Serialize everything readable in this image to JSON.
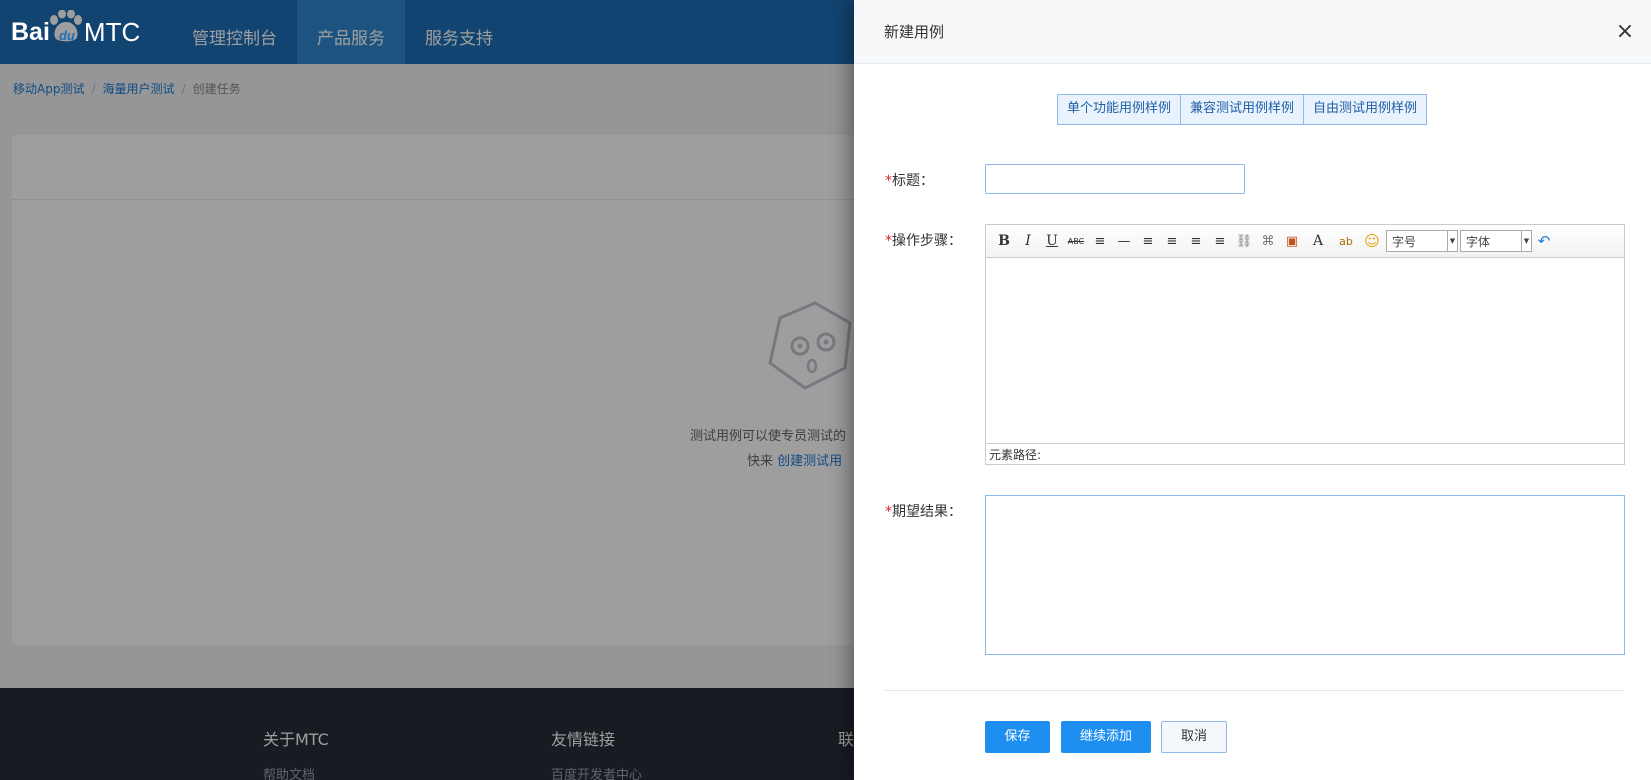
{
  "header": {
    "logo_bai": "Bai",
    "logo_du": "du",
    "logo_mtc": "MTC",
    "nav": [
      "管理控制台",
      "产品服务",
      "服务支持"
    ]
  },
  "breadcrumb": [
    "移动App测试",
    "海量用户测试",
    "创建任务"
  ],
  "empty_state": {
    "line1": "测试用例可以使专员测试的",
    "line2_prefix": "快来",
    "line2_link": "创建测试用"
  },
  "footer": {
    "col1_title": "关于MTC",
    "col1_link": "帮助文档",
    "col2_title": "友情链接",
    "col2_link": "百度开发者中心",
    "col3_title": "联"
  },
  "drawer": {
    "title": "新建用例",
    "close": "×",
    "samples": [
      "单个功能用例样例",
      "兼容测试用例样例",
      "自由测试用例样例"
    ],
    "required_mark": "*",
    "title_label": "标题：",
    "steps_label": "操作步骤：",
    "result_label": "期望结果：",
    "editor": {
      "toolbar": [
        "B",
        "I",
        "U",
        "ABC",
        "≡",
        "—",
        "≡",
        "≡",
        "≡",
        "≡",
        "⛓",
        "⌘",
        "▣",
        "A",
        "ab",
        "☺"
      ],
      "font_size_placeholder": "字号",
      "font_family_placeholder": "字体",
      "path_label": "元素路径:"
    },
    "buttons": {
      "save": "保存",
      "continue": "继续添加",
      "cancel": "取消"
    }
  }
}
